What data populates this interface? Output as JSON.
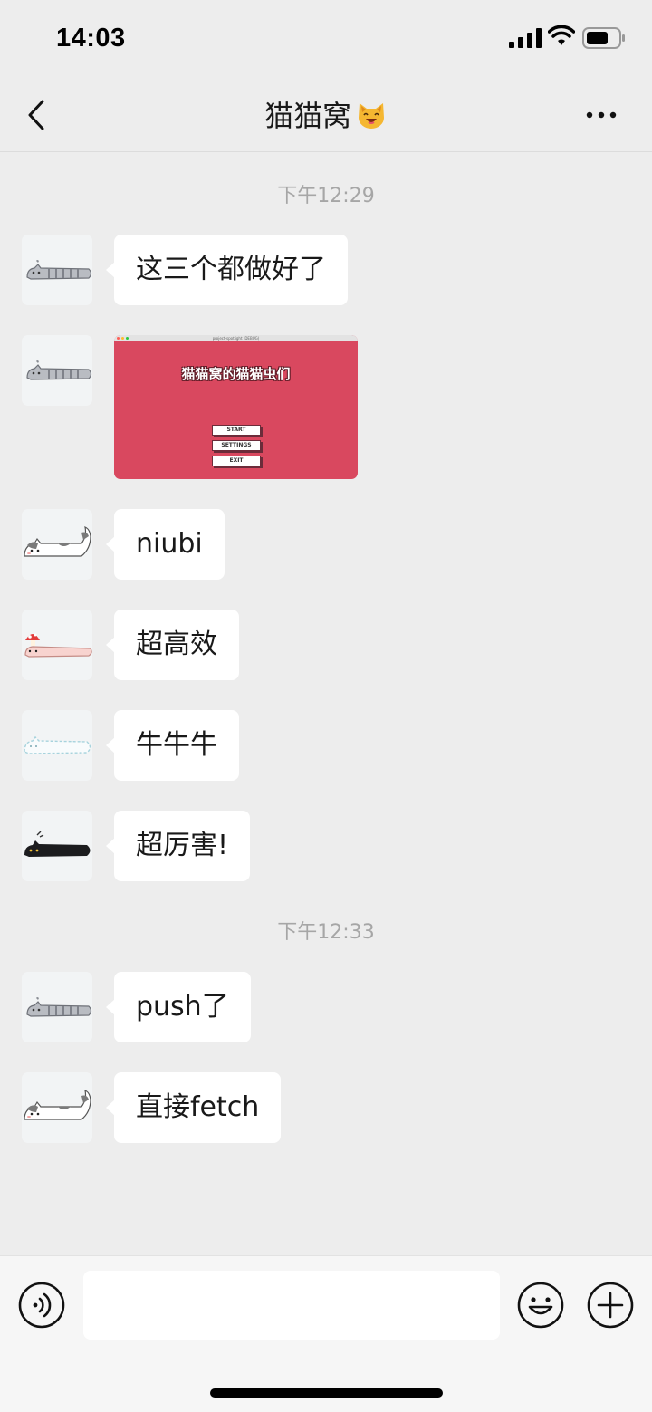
{
  "status_bar": {
    "time": "14:03"
  },
  "header": {
    "title": "猫猫窝"
  },
  "chat": {
    "timestamp_1": "下午12:29",
    "timestamp_2": "下午12:33",
    "messages": [
      {
        "sender_avatar": "gray-tabby-cat-avatar",
        "text": "这三个都做好了"
      },
      {
        "sender_avatar": "gray-tabby-cat-avatar",
        "type": "image",
        "image": {
          "window_title": "project-spotlight (DEBUG)",
          "game_title": "猫猫窝的猫猫虫们",
          "menu_buttons": [
            "START",
            "SETTINGS",
            "EXIT"
          ]
        }
      },
      {
        "sender_avatar": "calico-cat-avatar",
        "text": "niubi"
      },
      {
        "sender_avatar": "mushroom-cat-avatar",
        "text": "超高效"
      },
      {
        "sender_avatar": "white-cat-avatar",
        "text": "牛牛牛"
      },
      {
        "sender_avatar": "black-cat-avatar",
        "text": "超厉害!"
      },
      {
        "sender_avatar": "gray-tabby-cat-avatar",
        "text": "push了"
      },
      {
        "sender_avatar": "calico-cat-avatar",
        "text": "直接fetch"
      }
    ]
  },
  "input_bar": {
    "placeholder": "",
    "value": ""
  },
  "colors": {
    "background": "#ededed",
    "bubble": "#ffffff",
    "image_bg": "#d9485f"
  }
}
